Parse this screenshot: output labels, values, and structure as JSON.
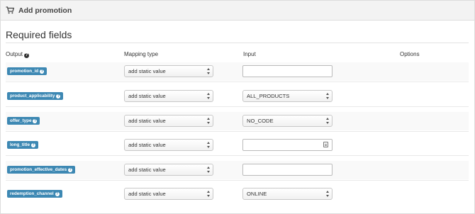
{
  "panel": {
    "title": "Add promotion",
    "icon": "cart-icon"
  },
  "section": {
    "title": "Required fields"
  },
  "columns": {
    "output": "Output",
    "mapping_type": "Mapping type",
    "input": "Input",
    "options": "Options"
  },
  "rows": [
    {
      "field": "promotion_id",
      "mapping": "add static value",
      "input_type": "text",
      "input_value": ""
    },
    {
      "field": "product_applicability",
      "mapping": "add static value",
      "input_type": "select",
      "input_value": "ALL_PRODUCTS"
    },
    {
      "field": "offer_type",
      "mapping": "add static value",
      "input_type": "select",
      "input_value": "NO_CODE"
    },
    {
      "field": "long_title",
      "mapping": "add static value",
      "input_type": "textarea",
      "input_value": ""
    },
    {
      "field": "promotion_effective_dates",
      "mapping": "add static value",
      "input_type": "text",
      "input_value": ""
    },
    {
      "field": "redemption_channel",
      "mapping": "add static value",
      "input_type": "select",
      "input_value": "ONLINE"
    }
  ],
  "colors": {
    "badge": "#3d88b3",
    "header_bg": "#f3f3f3"
  }
}
